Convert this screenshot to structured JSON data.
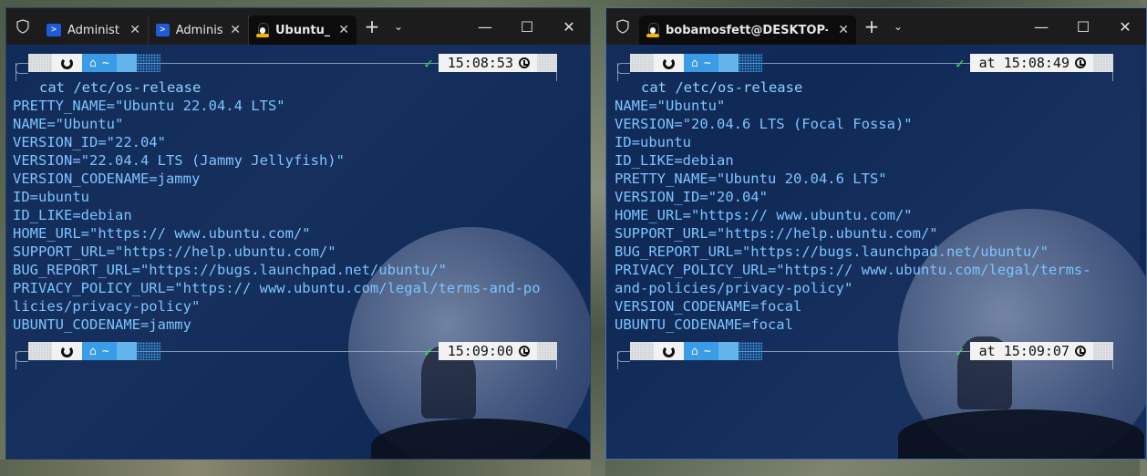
{
  "window1": {
    "tabs": [
      {
        "label": "Administ",
        "icon": "powershell-icon",
        "active": false
      },
      {
        "label": "Administ",
        "icon": "powershell-icon",
        "active": false
      },
      {
        "label": "Ubuntu_",
        "icon": "tux-icon",
        "active": true
      }
    ],
    "prompt_top": {
      "dir": "~",
      "time": "15:08:53"
    },
    "command": "cat /etc/os-release",
    "output": [
      "PRETTY_NAME=\"Ubuntu 22.04.4 LTS\"",
      "NAME=\"Ubuntu\"",
      "VERSION_ID=\"22.04\"",
      "VERSION=\"22.04.4 LTS (Jammy Jellyfish)\"",
      "VERSION_CODENAME=jammy",
      "ID=ubuntu",
      "ID_LIKE=debian",
      "HOME_URL=\"https:// www.ubuntu.com/\"",
      "SUPPORT_URL=\"https://help.ubuntu.com/\"",
      "BUG_REPORT_URL=\"https://bugs.launchpad.net/ubuntu/\"",
      "PRIVACY_POLICY_URL=\"https:// www.ubuntu.com/legal/terms-and-po",
      "licies/privacy-policy\"",
      "UBUNTU_CODENAME=jammy"
    ],
    "prompt_bottom": {
      "dir": "~",
      "time": "15:09:00"
    }
  },
  "window2": {
    "tabs": [
      {
        "label": "bobamosfett@DESKTOP-GRVZ",
        "icon": "tux-icon",
        "active": true
      }
    ],
    "prompt_top": {
      "dir": "~",
      "time": "at 15:08:49"
    },
    "command": "cat /etc/os-release",
    "output": [
      "NAME=\"Ubuntu\"",
      "VERSION=\"20.04.6 LTS (Focal Fossa)\"",
      "ID=ubuntu",
      "ID_LIKE=debian",
      "PRETTY_NAME=\"Ubuntu 20.04.6 LTS\"",
      "VERSION_ID=\"20.04\"",
      "HOME_URL=\"https:// www.ubuntu.com/\"",
      "SUPPORT_URL=\"https://help.ubuntu.com/\"",
      "BUG_REPORT_URL=\"https://bugs.launchpad.net/ubuntu/\"",
      "PRIVACY_POLICY_URL=\"https:// www.ubuntu.com/legal/terms-",
      "and-policies/privacy-policy\"",
      "VERSION_CODENAME=focal",
      "UBUNTU_CODENAME=focal"
    ],
    "prompt_bottom": {
      "dir": "~",
      "time": "at 15:09:07"
    }
  },
  "controls": {
    "new_tab": "+",
    "dropdown": "⌄",
    "minimize": "—",
    "maximize": "☐",
    "close": "✕",
    "tab_close": "✕"
  },
  "colors": {
    "terminal_bg": "#08245c",
    "terminal_text": "#7cc4ff",
    "prompt_blue": "#3b9ce6",
    "check_green": "#3ddc4f",
    "titlebar": "#1c1c1c"
  }
}
